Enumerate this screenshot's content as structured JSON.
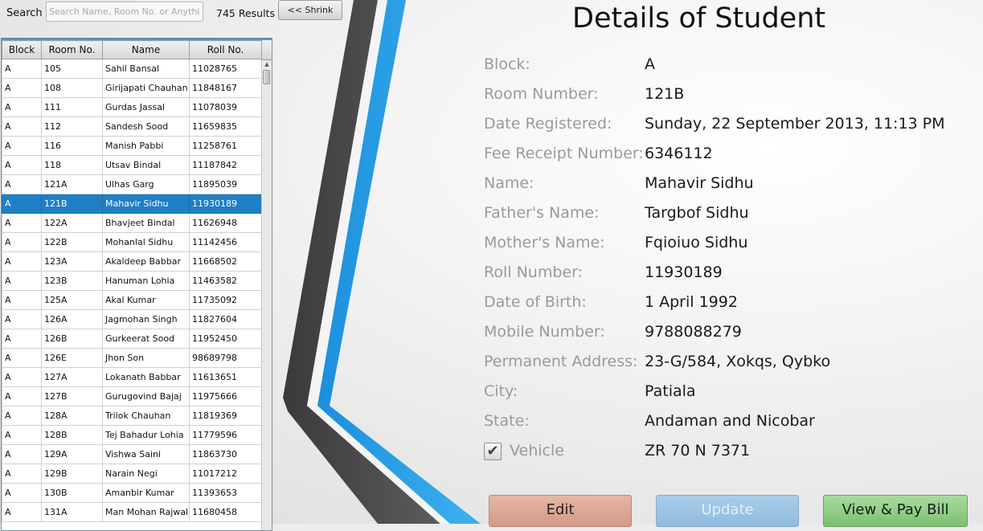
{
  "toolbar": {
    "search_label": "Search",
    "search_placeholder": "Search Name, Room No. or Anything",
    "results": "745 Results",
    "shrink_label": "<< Shrink"
  },
  "table": {
    "headers": [
      "Block",
      "Room No.",
      "Name",
      "Roll No."
    ],
    "selected_index": 7,
    "rows": [
      [
        "A",
        "105",
        "Sahil Bansal",
        "11028765"
      ],
      [
        "A",
        "108",
        "Girijapati Chauhan",
        "11848167"
      ],
      [
        "A",
        "111",
        "Gurdas Jassal",
        "11078039"
      ],
      [
        "A",
        "112",
        "Sandesh Sood",
        "11659835"
      ],
      [
        "A",
        "116",
        "Manish Pabbi",
        "11258761"
      ],
      [
        "A",
        "118",
        "Utsav Bindal",
        "11187842"
      ],
      [
        "A",
        "121A",
        "Ulhas Garg",
        "11895039"
      ],
      [
        "A",
        "121B",
        "Mahavir Sidhu",
        "11930189"
      ],
      [
        "A",
        "122A",
        "Bhavjeet Bindal",
        "11626948"
      ],
      [
        "A",
        "122B",
        "Mohanlal Sidhu",
        "11142456"
      ],
      [
        "A",
        "123A",
        "Akaldeep Babbar",
        "11668502"
      ],
      [
        "A",
        "123B",
        "Hanuman Lohia",
        "11463582"
      ],
      [
        "A",
        "125A",
        "Akal Kumar",
        "11735092"
      ],
      [
        "A",
        "126A",
        "Jagmohan Singh",
        "11827604"
      ],
      [
        "A",
        "126B",
        "Gurkeerat Sood",
        "11952450"
      ],
      [
        "A",
        "126E",
        "Jhon Son",
        "98689798"
      ],
      [
        "A",
        "127A",
        "Lokanath Babbar",
        "11613651"
      ],
      [
        "A",
        "127B",
        "Gurugovind Bajaj",
        "11975666"
      ],
      [
        "A",
        "128A",
        "Trilok Chauhan",
        "11819369"
      ],
      [
        "A",
        "128B",
        "Tej Bahadur Lohia",
        "11779596"
      ],
      [
        "A",
        "129A",
        "Vishwa Saini",
        "11863730"
      ],
      [
        "A",
        "129B",
        "Narain Negi",
        "11017212"
      ],
      [
        "A",
        "130B",
        "Amanbir Kumar",
        "11393653"
      ],
      [
        "A",
        "131A",
        "Man Mohan Rajwal",
        "11680458"
      ]
    ]
  },
  "details": {
    "title": "Details of Student",
    "fields": [
      {
        "label": "Block:",
        "value": "A"
      },
      {
        "label": "Room Number:",
        "value": "121B"
      },
      {
        "label": "Date Registered:",
        "value": "Sunday, 22 September 2013, 11:13 PM"
      },
      {
        "label": "Fee Receipt Number:",
        "value": "6346112"
      },
      {
        "label": "Name:",
        "value": "Mahavir Sidhu"
      },
      {
        "label": "Father's Name:",
        "value": "Targbof Sidhu"
      },
      {
        "label": "Mother's Name:",
        "value": "Fqioiuo Sidhu"
      },
      {
        "label": "Roll Number:",
        "value": "11930189"
      },
      {
        "label": "Date of Birth:",
        "value": "1 April 1992"
      },
      {
        "label": "Mobile Number:",
        "value": "9788088279"
      },
      {
        "label": "Permanent Address:",
        "value": "23-G/584, Xokqs, Qybko"
      },
      {
        "label": "City:",
        "value": "Patiala"
      },
      {
        "label": "State:",
        "value": "Andaman and Nicobar"
      }
    ],
    "vehicle": {
      "label": "Vehicle",
      "checked": true,
      "check_glyph": "✔",
      "value": "ZR 70 N 7371"
    }
  },
  "actions": {
    "edit": "Edit",
    "update": "Update",
    "pay": "View & Pay Bill"
  },
  "colors": {
    "selection": "#1e7fc7",
    "swoosh_blue": "#2aa0e6",
    "swoosh_dark": "#4a4a4a"
  }
}
